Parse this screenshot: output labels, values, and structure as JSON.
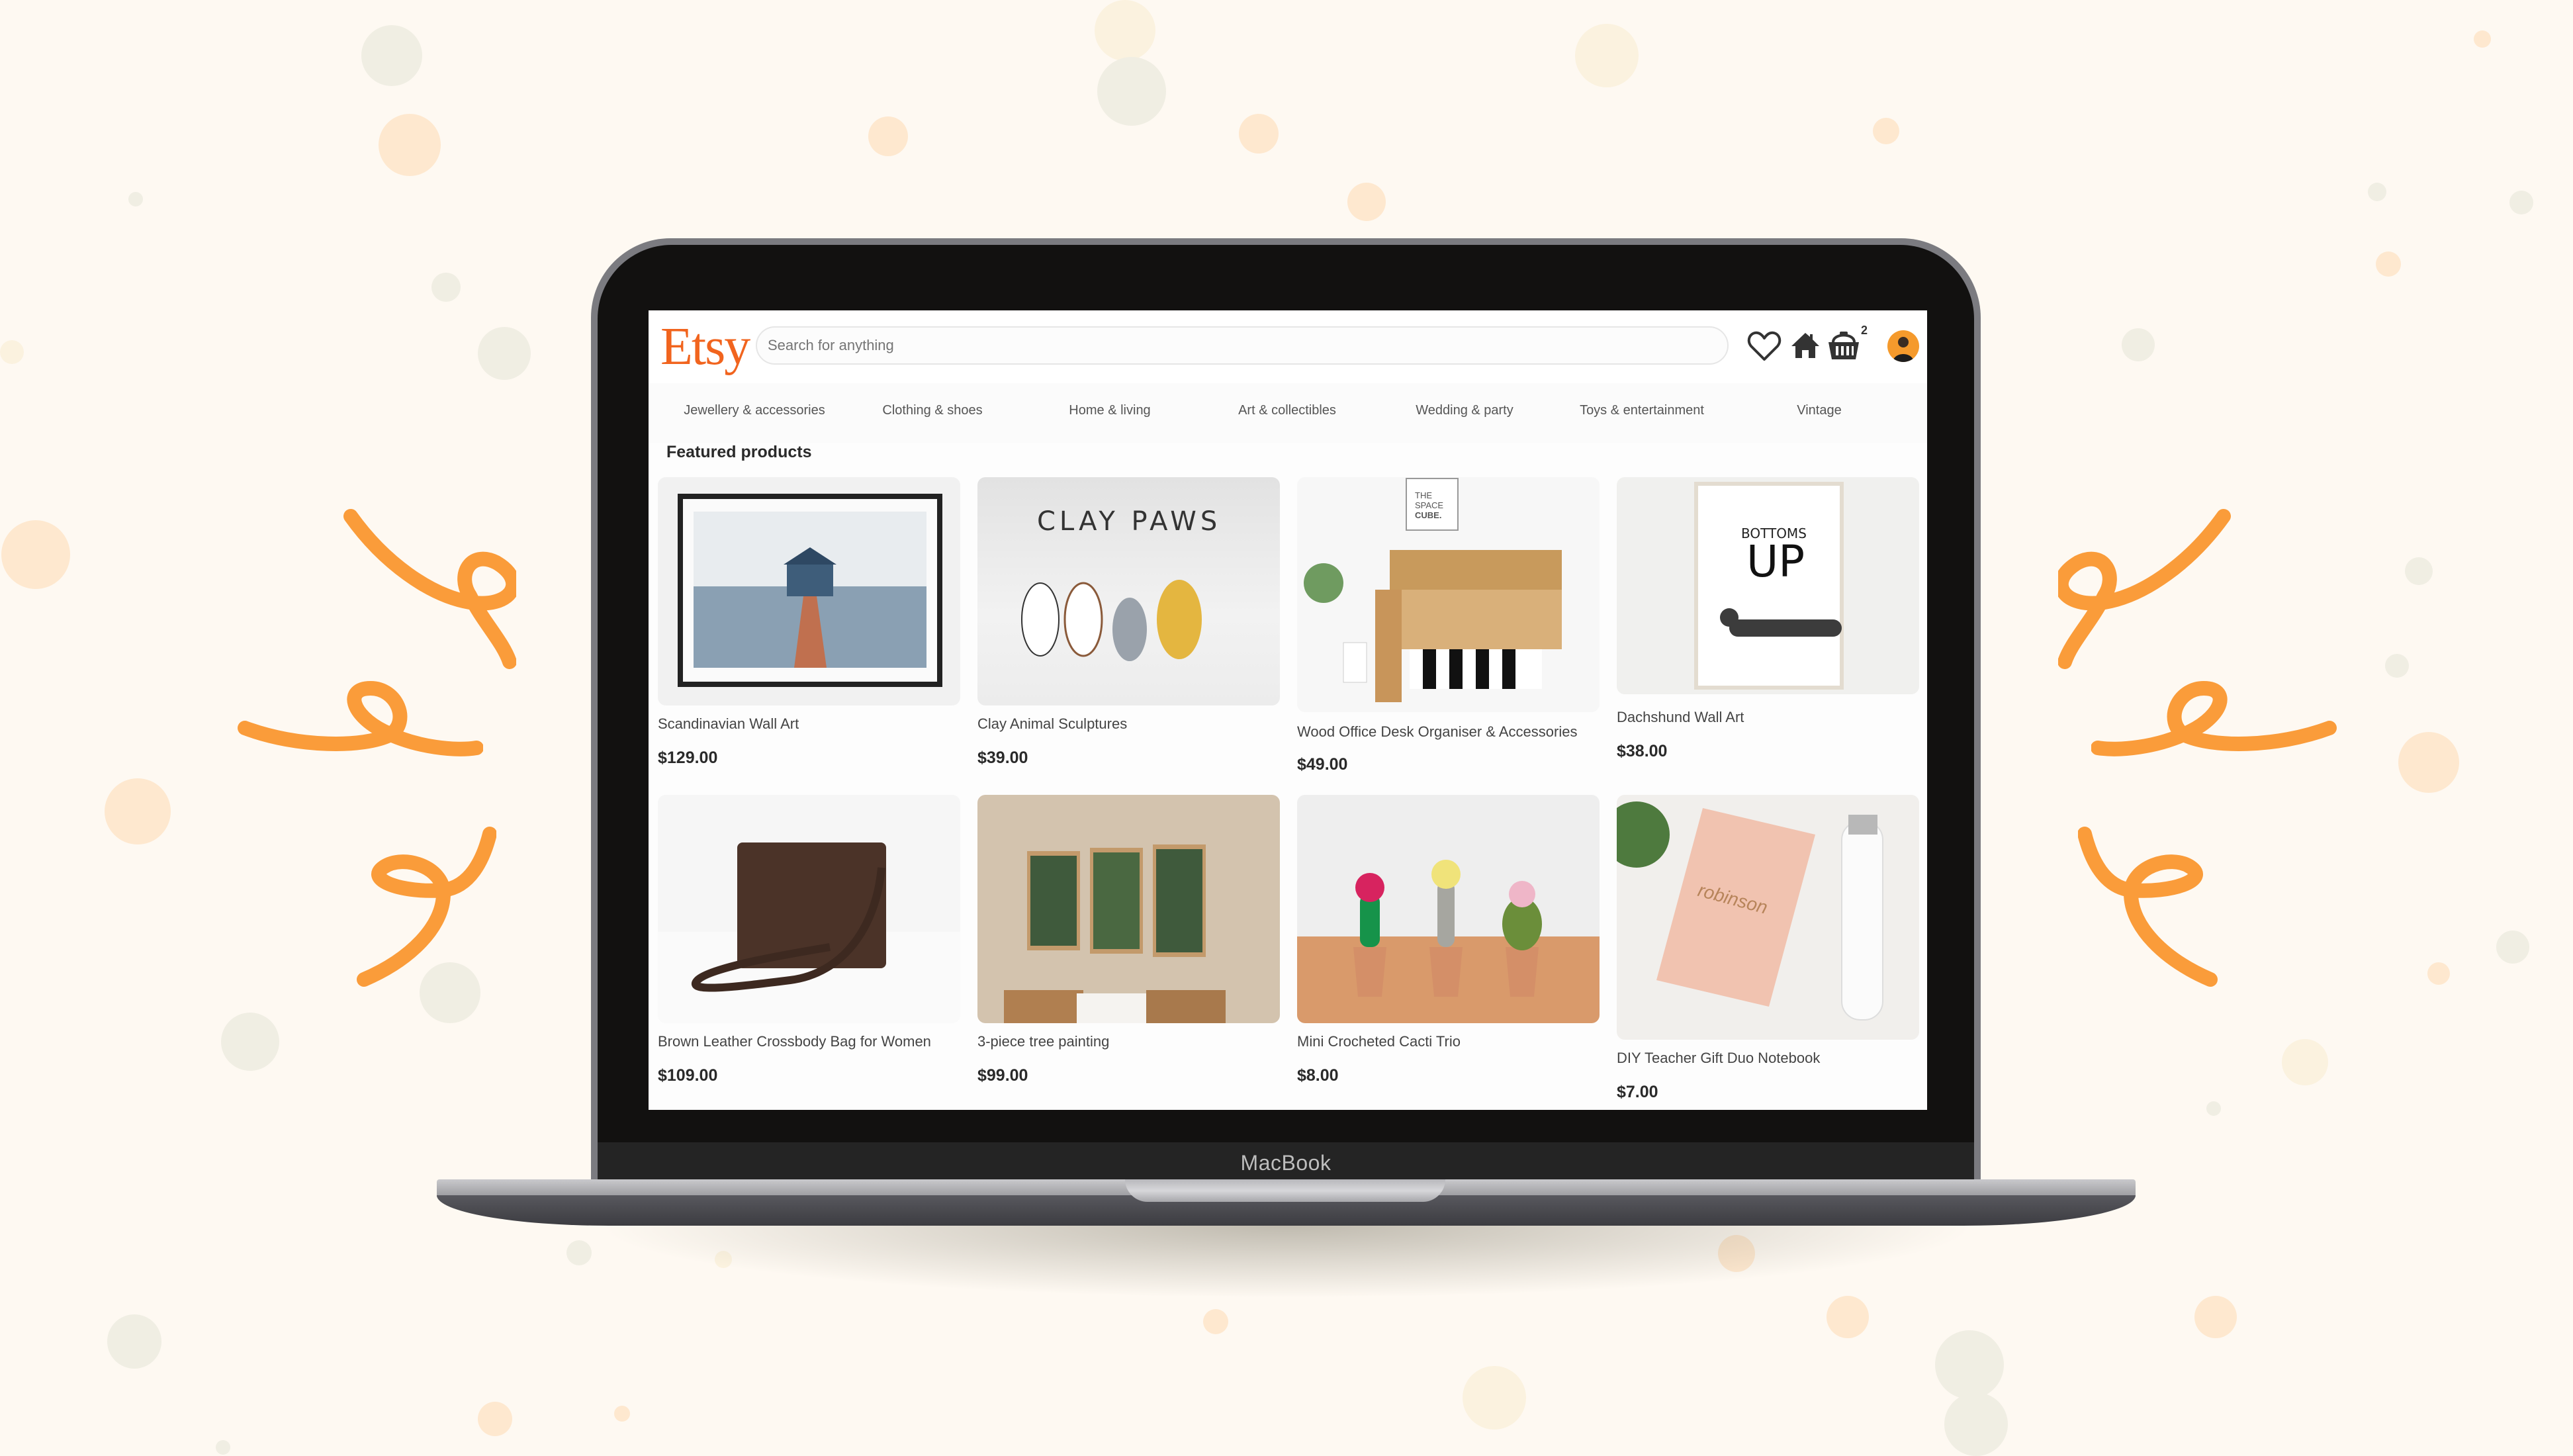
{
  "background": {
    "color": "#fef9f2",
    "accent_swirl_color": "#fa9c3a"
  },
  "device": {
    "label": "MacBook"
  },
  "app": {
    "logo": "Etsy",
    "brand_color": "#f1641e",
    "search": {
      "placeholder": "Search for anything",
      "value": ""
    },
    "header_icons": [
      {
        "name": "favorites",
        "icon": "heart-icon"
      },
      {
        "name": "shop",
        "icon": "home-icon"
      },
      {
        "name": "cart",
        "icon": "basket-icon",
        "badge": "2"
      },
      {
        "name": "account",
        "icon": "avatar"
      }
    ],
    "categories": [
      "Jewellery & accessories",
      "Clothing & shoes",
      "Home & living",
      "Art & collectibles",
      "Wedding & party",
      "Toys & entertainment",
      "Vintage"
    ],
    "section_title": "Featured products",
    "products": [
      {
        "name": "Scandinavian Wall Art",
        "price": "$129.00",
        "image": "framed boathouse on water print"
      },
      {
        "name": "Clay Animal Sculptures",
        "price": "$39.00",
        "image": "clay dogs and cats with 'CLAY PAWS' text"
      },
      {
        "name": "Wood Office Desk Organiser & Accessories",
        "price": "$49.00",
        "image": "wooden desk organiser with plant"
      },
      {
        "name": "Dachshund Wall Art",
        "price": "$38.00",
        "image": "framed 'BOTTOMS UP' dachshund print"
      },
      {
        "name": "Brown Leather Crossbody Bag for Women",
        "price": "$109.00",
        "image": "brown leather crossbody bag"
      },
      {
        "name": "3-piece tree painting",
        "price": "$99.00",
        "image": "three framed forest prints above bed"
      },
      {
        "name": "Mini Crocheted Cacti Trio",
        "price": "$8.00",
        "image": "three crocheted cacti in terracotta pots"
      },
      {
        "name": "DIY Teacher Gift Duo Notebook",
        "price": "$7.00",
        "image": "pink notebook and bottle 'Miss Robinson'"
      }
    ]
  }
}
